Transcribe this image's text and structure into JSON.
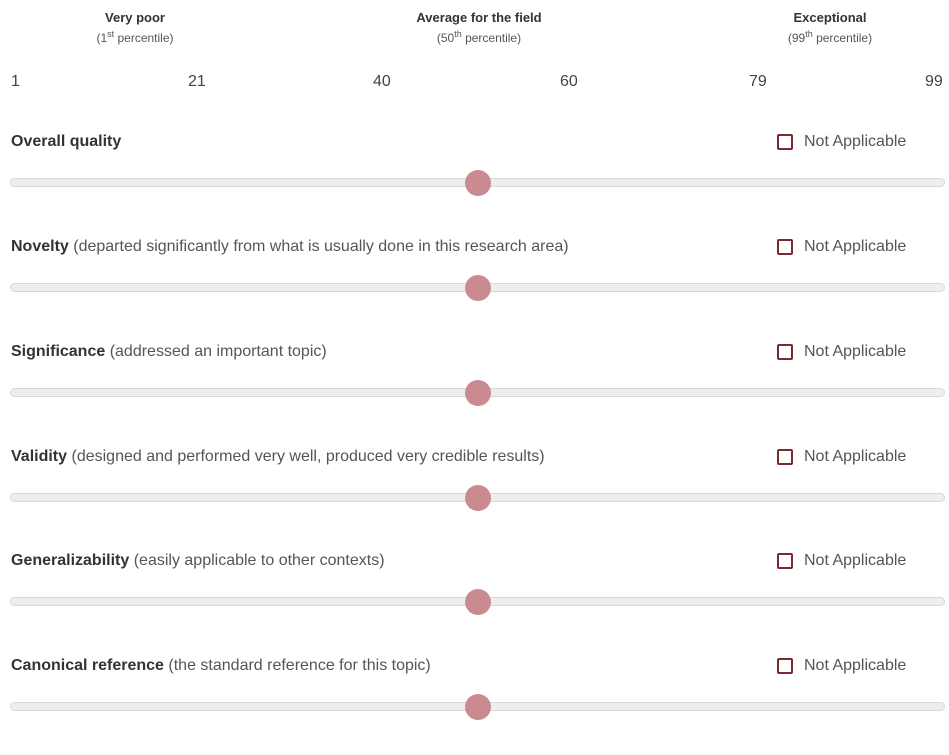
{
  "scale": {
    "anchors": [
      {
        "title": "Very poor",
        "sub_prefix": "(1",
        "sub_sup": "st",
        "sub_suffix": " percentile)"
      },
      {
        "title": "Average for the field",
        "sub_prefix": "(50",
        "sub_sup": "th",
        "sub_suffix": " percentile)"
      },
      {
        "title": "Exceptional",
        "sub_prefix": "(99",
        "sub_sup": "th",
        "sub_suffix": " percentile)"
      }
    ],
    "ticks": [
      "1",
      "21",
      "40",
      "60",
      "79",
      "99"
    ],
    "min": 1,
    "max": 99
  },
  "na_label": "Not Applicable",
  "colors": {
    "thumb": "#c98b8f",
    "checkbox_border": "#7a2a31",
    "track": "#eeeeee"
  },
  "questions": [
    {
      "title": "Overall quality",
      "desc": "",
      "value": 50,
      "not_applicable": false
    },
    {
      "title": "Novelty",
      "desc": "(departed significantly from what is usually done in this research area)",
      "value": 50,
      "not_applicable": false
    },
    {
      "title": "Significance",
      "desc": "(addressed an important topic)",
      "value": 50,
      "not_applicable": false
    },
    {
      "title": "Validity",
      "desc": "(designed and performed very well, produced very credible results)",
      "value": 50,
      "not_applicable": false
    },
    {
      "title": "Generalizability",
      "desc": "(easily applicable to other contexts)",
      "value": 50,
      "not_applicable": false
    },
    {
      "title": "Canonical reference",
      "desc": "(the standard reference for this topic)",
      "value": 50,
      "not_applicable": false
    }
  ]
}
